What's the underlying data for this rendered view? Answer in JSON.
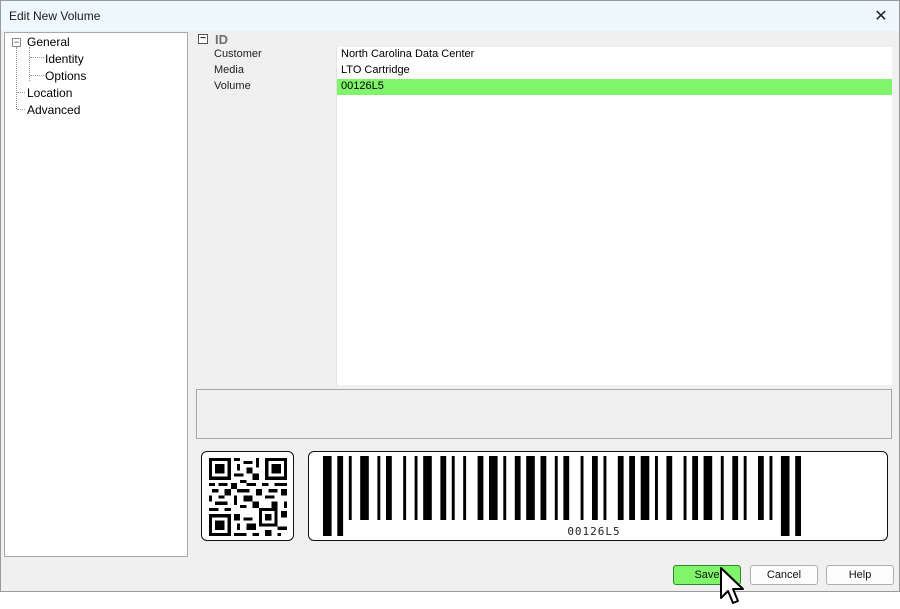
{
  "window": {
    "title": "Edit New Volume"
  },
  "tree": {
    "items": [
      {
        "label": "General",
        "expanded": true
      },
      {
        "label": "Identity"
      },
      {
        "label": "Options"
      },
      {
        "label": "Location"
      },
      {
        "label": "Advanced"
      }
    ]
  },
  "grid": {
    "category": "ID",
    "rows": [
      {
        "name": "Customer",
        "value": "North Carolina Data Center"
      },
      {
        "name": "Media",
        "value": "LTO Cartridge"
      },
      {
        "name": "Volume",
        "value": "00126L5"
      }
    ]
  },
  "barcode": {
    "text": "00126L5"
  },
  "buttons": {
    "save": "Save",
    "cancel": "Cancel",
    "help": "Help"
  },
  "colors": {
    "accent": "#80f46a",
    "titlebar": "#eef7fb"
  },
  "icons": {
    "close": "close-icon",
    "expand": "minus-box-icon"
  }
}
